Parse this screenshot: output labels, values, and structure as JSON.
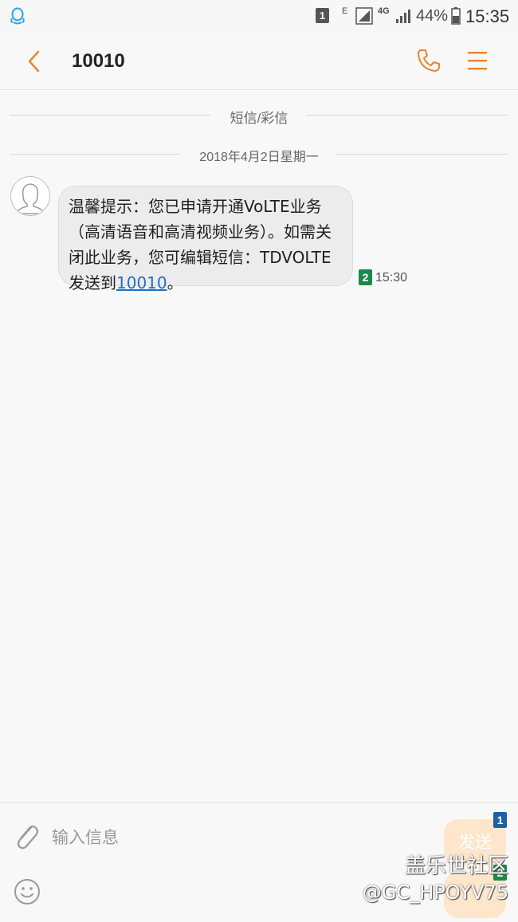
{
  "status_bar": {
    "notif_icon": "qq-penguin-icon",
    "sim_label": "1",
    "network_e": "E",
    "network_4g": "4G",
    "battery": "44%",
    "time": "15:35"
  },
  "header": {
    "title": "10010",
    "back_icon": "chevron-left-icon",
    "call_icon": "phone-icon",
    "menu_icon": "menu-icon",
    "accent": "#e8862d"
  },
  "thread": {
    "section_label": "短信/彩信",
    "date_label": "2018年4月2日星期一",
    "messages": [
      {
        "avatar": "person-avatar-icon",
        "text_before": "温馨提示：您已申请开通VoLTE业务（高清语音和高清视频业务）。如需关闭此业务，您可编辑短信：TDVOLTE发送到",
        "link": "10010",
        "text_after": "。",
        "sim": "2",
        "sim_color": "#1a8a4a",
        "time": "15:30"
      }
    ]
  },
  "composer": {
    "placeholder": "输入信息",
    "attach_icon": "paperclip-icon",
    "emoji_icon": "emoji-smile-icon",
    "send_label": "发送",
    "send_sim1": "1",
    "send_sim2": "2",
    "sim1_color": "#1f5fa8",
    "sim2_color": "#1a8a4a"
  },
  "watermark": {
    "brand": "盖乐世社区",
    "user": "@GC_HPOYV75"
  }
}
